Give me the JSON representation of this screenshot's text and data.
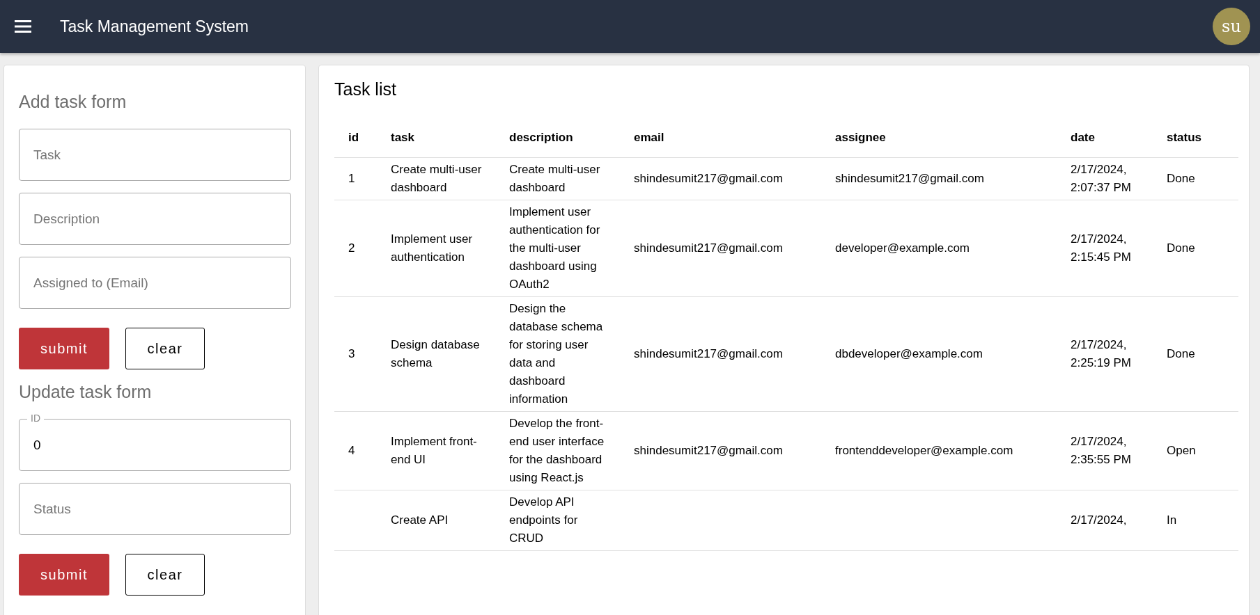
{
  "app_bar": {
    "title": "Task Management System",
    "avatar": "su"
  },
  "add_form": {
    "title": "Add task form",
    "fields": [
      {
        "placeholder": "Task"
      },
      {
        "placeholder": "Description"
      },
      {
        "placeholder": "Assigned to (Email)"
      }
    ],
    "buttons": [
      {
        "label": "submit",
        "kind": "primary"
      },
      {
        "label": "clear",
        "kind": "outline"
      }
    ]
  },
  "update_form": {
    "title": "Update task form",
    "fields": [
      {
        "label": "ID",
        "value": "0"
      },
      {
        "placeholder": "Status"
      }
    ],
    "buttons": [
      {
        "label": "submit",
        "kind": "primary"
      },
      {
        "label": "clear",
        "kind": "outline"
      }
    ]
  },
  "task_list": {
    "title": "Task list",
    "columns": [
      "id",
      "task",
      "description",
      "email",
      "assignee",
      "date",
      "status"
    ],
    "rows": [
      [
        "1",
        "Create multi-user dashboard",
        "Create multi-user dashboard",
        "shindesumit217@gmail.com",
        "shindesumit217@gmail.com",
        "2/17/2024, 2:07:37 PM",
        "Done"
      ],
      [
        "2",
        "Implement user authentication",
        "Implement user authentication for the multi-user dashboard using OAuth2",
        "shindesumit217@gmail.com",
        "developer@example.com",
        "2/17/2024, 2:15:45 PM",
        "Done"
      ],
      [
        "3",
        "Design database schema",
        "Design the database schema for storing user data and dashboard information",
        "shindesumit217@gmail.com",
        "dbdeveloper@example.com",
        "2/17/2024, 2:25:19 PM",
        "Done"
      ],
      [
        "4",
        "Implement front-end UI",
        "Develop the front-end user interface for the dashboard using React.js",
        "shindesumit217@gmail.com",
        "frontenddeveloper@example.com",
        "2/17/2024, 2:35:55 PM",
        "Open"
      ],
      [
        "",
        "Create API",
        "Develop API endpoints for CRUD",
        "",
        "",
        "2/17/2024,",
        "In"
      ]
    ]
  }
}
